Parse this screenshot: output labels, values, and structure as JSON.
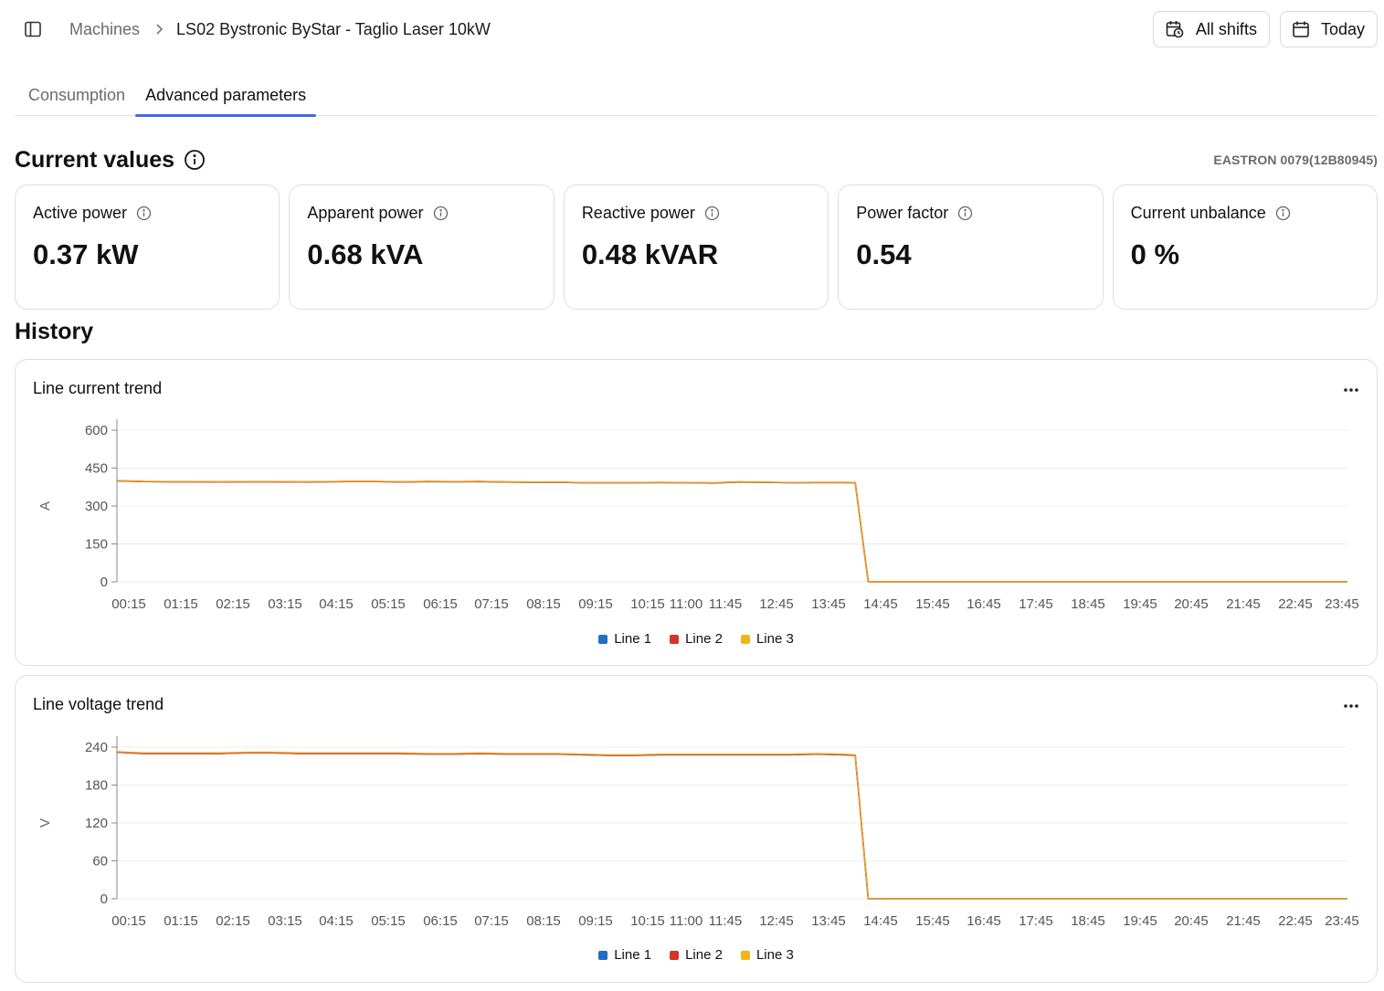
{
  "header": {
    "breadcrumb_root": "Machines",
    "breadcrumb_current": "LS02 Bystronic ByStar - Taglio Laser 10kW",
    "shifts_label": "All shifts",
    "date_label": "Today"
  },
  "tabs": [
    {
      "label": "Consumption"
    },
    {
      "label": "Advanced parameters"
    }
  ],
  "current_values": {
    "title": "Current values",
    "device": "EASTRON 0079(12B80945)",
    "kpis": [
      {
        "label": "Active power",
        "value": "0.37 kW"
      },
      {
        "label": "Apparent power",
        "value": "0.68 kVA"
      },
      {
        "label": "Reactive power",
        "value": "0.48 kVAR"
      },
      {
        "label": "Power factor",
        "value": "0.54"
      },
      {
        "label": "Current unbalance",
        "value": "0 %"
      }
    ]
  },
  "history": {
    "title": "History"
  },
  "colors": {
    "line1": "#1f6fc5",
    "line2": "#d33527",
    "line3": "#f2b41a",
    "accent": "#4466e6"
  },
  "chart_data": [
    {
      "type": "line",
      "title": "Line current trend",
      "ylabel": "A",
      "ylim": [
        0,
        600
      ],
      "yticks": [
        0,
        150,
        300,
        450,
        600
      ],
      "xlabels": [
        "00:15",
        "01:15",
        "02:15",
        "03:15",
        "04:15",
        "05:15",
        "06:15",
        "07:15",
        "08:15",
        "09:15",
        "10:15",
        "11:00",
        "11:45",
        "12:45",
        "13:45",
        "14:45",
        "15:45",
        "16:45",
        "17:45",
        "18:45",
        "19:45",
        "20:45",
        "21:45",
        "22:45",
        "23:45"
      ],
      "x": [
        "00:00",
        "00:30",
        "01:00",
        "01:30",
        "02:00",
        "02:30",
        "03:00",
        "03:30",
        "04:00",
        "04:30",
        "05:00",
        "05:30",
        "06:00",
        "06:30",
        "07:00",
        "07:30",
        "08:00",
        "08:30",
        "09:00",
        "09:30",
        "10:00",
        "10:30",
        "11:00",
        "11:30",
        "12:00",
        "12:30",
        "13:00",
        "13:30",
        "14:00",
        "14:15",
        "14:30",
        "15:00",
        "16:00",
        "17:00",
        "18:00",
        "19:00",
        "20:00",
        "21:00",
        "22:00",
        "23:00",
        "23:45"
      ],
      "series": [
        {
          "name": "Line 1",
          "values": [
            400,
            397,
            396,
            396,
            395,
            396,
            396,
            395,
            396,
            397,
            397,
            395,
            397,
            396,
            397,
            395,
            394,
            394,
            392,
            392,
            392,
            393,
            392,
            391,
            395,
            394,
            392,
            393,
            393,
            392,
            0,
            0,
            0,
            0,
            0,
            0,
            0,
            0,
            0,
            0,
            0
          ]
        },
        {
          "name": "Line 2",
          "values": [
            400,
            397,
            396,
            396,
            395,
            396,
            396,
            395,
            396,
            397,
            397,
            395,
            397,
            396,
            397,
            395,
            394,
            394,
            392,
            392,
            392,
            393,
            392,
            391,
            395,
            394,
            392,
            393,
            393,
            392,
            0,
            0,
            0,
            0,
            0,
            0,
            0,
            0,
            0,
            0,
            0
          ]
        },
        {
          "name": "Line 3",
          "values": [
            401,
            398,
            397,
            397,
            396,
            397,
            397,
            396,
            397,
            398,
            398,
            396,
            398,
            397,
            398,
            396,
            395,
            395,
            393,
            393,
            393,
            394,
            393,
            392,
            396,
            395,
            393,
            394,
            394,
            393,
            0,
            0,
            0,
            0,
            0,
            0,
            0,
            0,
            0,
            0,
            0
          ]
        }
      ]
    },
    {
      "type": "line",
      "title": "Line voltage trend",
      "ylabel": "V",
      "ylim": [
        0,
        240
      ],
      "yticks": [
        0,
        60,
        120,
        180,
        240
      ],
      "xlabels": [
        "00:15",
        "01:15",
        "02:15",
        "03:15",
        "04:15",
        "05:15",
        "06:15",
        "07:15",
        "08:15",
        "09:15",
        "10:15",
        "11:00",
        "11:45",
        "12:45",
        "13:45",
        "14:45",
        "15:45",
        "16:45",
        "17:45",
        "18:45",
        "19:45",
        "20:45",
        "21:45",
        "22:45",
        "23:45"
      ],
      "x": [
        "00:00",
        "00:30",
        "01:00",
        "01:30",
        "02:00",
        "02:30",
        "03:00",
        "03:30",
        "04:00",
        "04:30",
        "05:00",
        "05:30",
        "06:00",
        "06:30",
        "07:00",
        "07:30",
        "08:00",
        "08:30",
        "09:00",
        "09:30",
        "10:00",
        "10:30",
        "11:00",
        "11:30",
        "12:00",
        "12:30",
        "13:00",
        "13:30",
        "14:00",
        "14:15",
        "14:30",
        "15:00",
        "16:00",
        "17:00",
        "18:00",
        "19:00",
        "20:00",
        "21:00",
        "22:00",
        "23:00",
        "23:45"
      ],
      "series": [
        {
          "name": "Line 1",
          "values": [
            232,
            230,
            230,
            230,
            230,
            231,
            231,
            230,
            230,
            230,
            230,
            230,
            229,
            229,
            230,
            229,
            229,
            229,
            228,
            227,
            227,
            228,
            228,
            228,
            228,
            228,
            228,
            229,
            228,
            227,
            0,
            0,
            0,
            0,
            0,
            0,
            0,
            0,
            0,
            0,
            0
          ]
        },
        {
          "name": "Line 2",
          "values": [
            232,
            230,
            230,
            230,
            230,
            231,
            231,
            230,
            230,
            230,
            230,
            230,
            229,
            229,
            230,
            229,
            229,
            229,
            228,
            227,
            227,
            228,
            228,
            228,
            228,
            228,
            228,
            229,
            228,
            227,
            0,
            0,
            0,
            0,
            0,
            0,
            0,
            0,
            0,
            0,
            0
          ]
        },
        {
          "name": "Line 3",
          "values": [
            233,
            231,
            231,
            231,
            231,
            232,
            232,
            231,
            231,
            231,
            231,
            231,
            230,
            230,
            231,
            230,
            230,
            230,
            229,
            228,
            228,
            229,
            229,
            229,
            229,
            229,
            229,
            230,
            229,
            228,
            0,
            0,
            0,
            0,
            0,
            0,
            0,
            0,
            0,
            0,
            0
          ]
        }
      ]
    }
  ]
}
